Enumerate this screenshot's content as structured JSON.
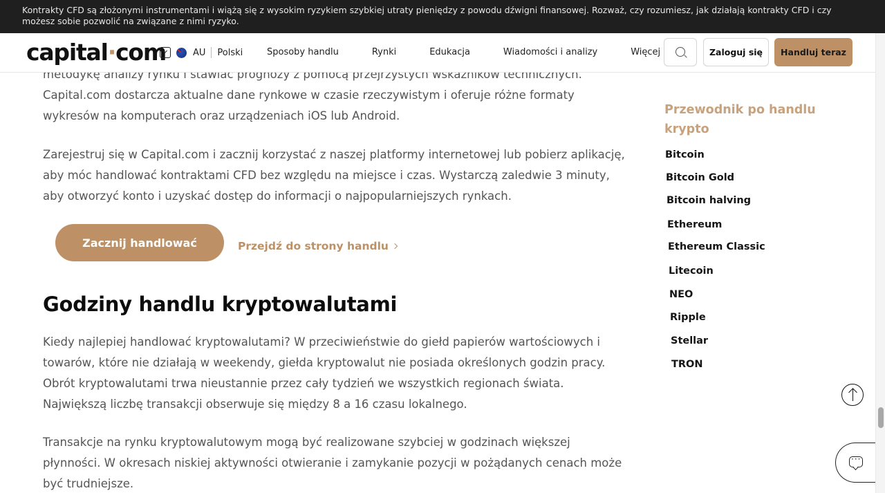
{
  "risk_banner": {
    "text": "Kontrakty CFD są złożonymi instrumentami i wiążą się z wysokim ryzykiem szybkiej utraty pieniędzy z powodu dźwigni finansowej. Rozważ, czy rozumiesz, jak działają kontrakty CFD i czy możesz sobie pozwolić na związane z nimi ryzyko."
  },
  "header": {
    "logo_left": "capital",
    "logo_dot": "·",
    "logo_right": "com",
    "region_code": "AU",
    "language": "Polski",
    "nav": [
      "Sposoby handlu",
      "Rynki",
      "Edukacja",
      "Wiadomości i analizy",
      "Więcej"
    ],
    "login_label": "Zaloguj się",
    "trade_label": "Handluj teraz"
  },
  "main": {
    "para0": "metodykę analizy rynku i stawiać prognozy z pomocą przejrzystych wskaźników technicznych. Capital.com dostarcza aktualne dane rynkowe w czasie rzeczywistym i oferuje różne formaty wykresów na komputerach oraz urządzeniach iOS lub Android.",
    "para1": "Zarejestruj się w Capital.com i zacznij korzystać z naszej platformy internetowej lub pobierz aplikację, aby móc handlować kontraktami CFD bez względu na miejsce i czas. Wystarczą zaledwie 3 minuty, aby otworzyć konto i uzyskać dostęp do informacji o najpopularniejszych rynkach.",
    "cta_primary": "Zacznij handlować",
    "cta_secondary": "Przejdź do strony handlu",
    "heading": "Godziny handlu kryptowalutami",
    "para3": "Kiedy najlepiej handlować kryptowalutami? W przeciwieństwie do giełd papierów wartościowych i towarów, które nie działają w weekendy, giełda kryptowalut nie posiada określonych godzin pracy. Obrót kryptowalutami trwa nieustannie przez cały tydzień we wszystkich regionach świata. Największą liczbę transakcji obserwuje się między 8 a 16 czasu lokalnego.",
    "para4": "Transakcje na rynku kryptowalutowym mogą być realizowane szybciej w godzinach większej płynności. W okresach niskiej aktywności otwieranie i zamykanie pozycji w pożądanych cenach może być trudniejsze."
  },
  "sidebar": {
    "title": "Przewodnik po handlu krypto",
    "items": [
      "Bitcoin",
      "Bitcoin Gold",
      "Bitcoin halving",
      "Ethereum",
      "Ethereum Classic",
      "Litecoin",
      "NEO",
      "Ripple",
      "Stellar",
      "TRON"
    ]
  },
  "icons": {
    "search": "search-icon",
    "scroll_top": "arrow-up-icon",
    "chat": "chat-icon",
    "region_toggle": "chevron-down-icon",
    "flag": "australia-flag-icon"
  },
  "colors": {
    "accent": "#bd9165",
    "banner_bg": "#1f1f1f",
    "sidebar_title": "#c8a27c"
  }
}
